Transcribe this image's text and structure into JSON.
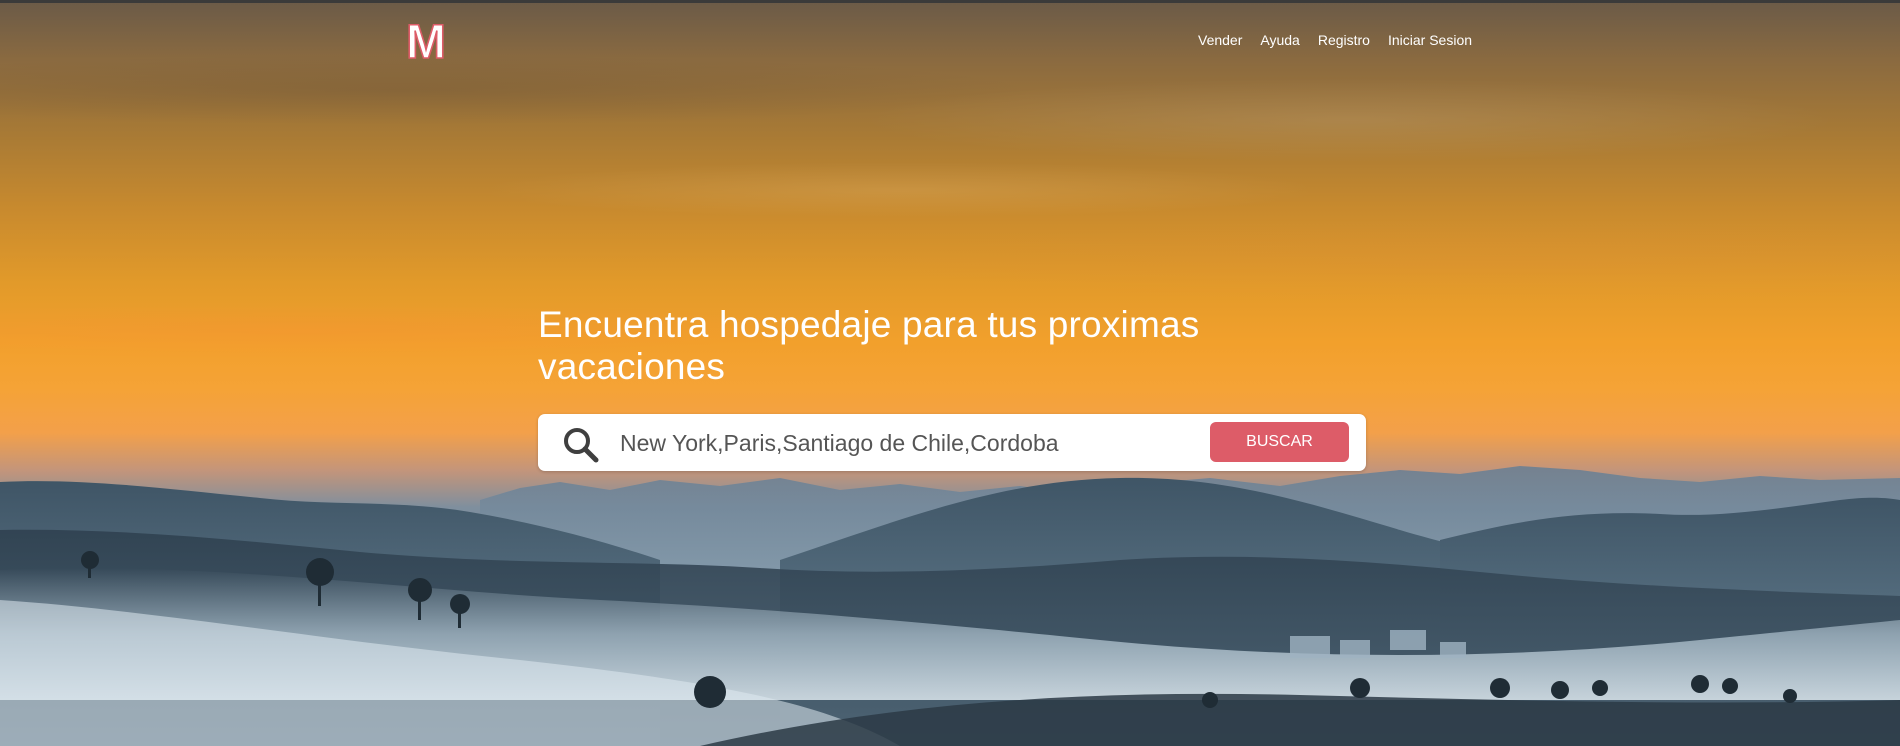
{
  "brand": {
    "logo_letter": "M",
    "logo_color": "#ffffff",
    "logo_outline_color": "#dd5c68"
  },
  "nav": {
    "items": [
      {
        "label": "Vender"
      },
      {
        "label": "Ayuda"
      },
      {
        "label": "Registro"
      },
      {
        "label": "Iniciar Sesion"
      }
    ]
  },
  "hero": {
    "headline_line1": "Encuentra hospedaje para tus proximas",
    "headline_line2": "vacaciones"
  },
  "search": {
    "icon": "search-icon",
    "value": "New York,Paris,Santiago de Chile,Cordoba",
    "button_label": "BUSCAR",
    "button_color": "#dd5c68"
  }
}
